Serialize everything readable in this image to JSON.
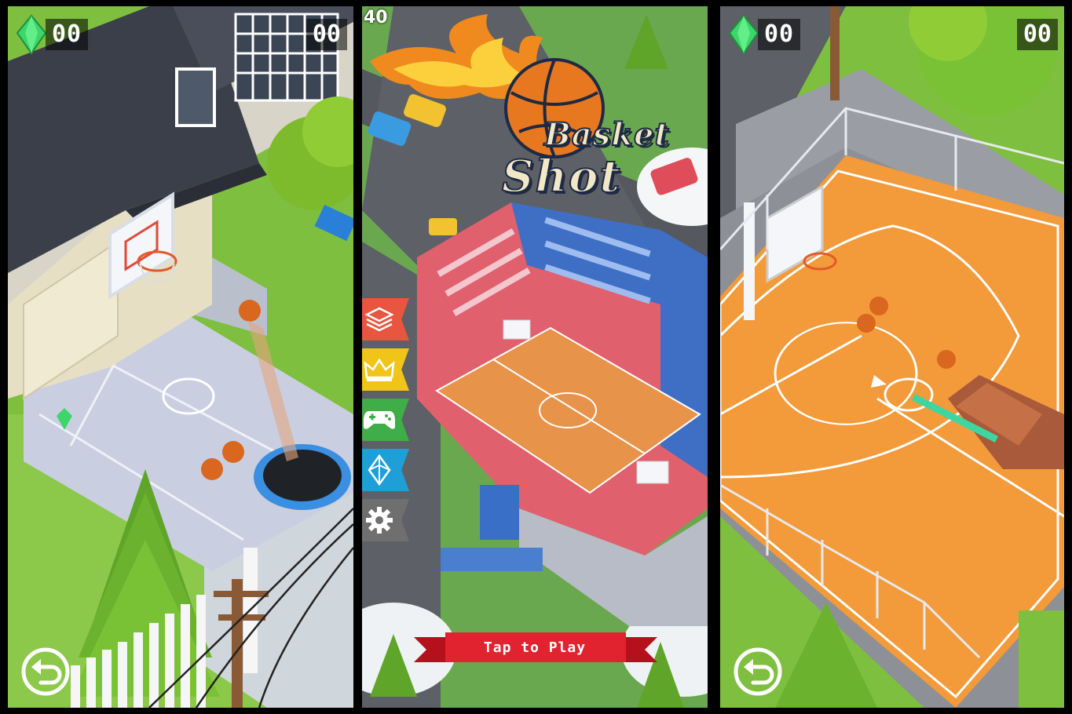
{
  "screens": [
    {
      "id": "backyard",
      "gems": "00",
      "score": "00",
      "back_icon": "undo-arrow-icon"
    },
    {
      "id": "title",
      "fps": "40",
      "logo_line1": "Basket",
      "logo_line2": "Shot",
      "tap_to_play": "Tap to Play",
      "menu": [
        {
          "icon": "layers-icon",
          "color": "#e8563f"
        },
        {
          "icon": "crown-icon",
          "color": "#f0c419"
        },
        {
          "icon": "gamepad-icon",
          "color": "#3fae49"
        },
        {
          "icon": "diamond-icon",
          "color": "#1f9fd8"
        },
        {
          "icon": "gear-icon",
          "color": "#6f6f6f"
        }
      ]
    },
    {
      "id": "court",
      "gems": "00",
      "score": "00",
      "back_icon": "undo-arrow-icon"
    }
  ],
  "colors": {
    "gem": "#3ed66a",
    "banner_red": "#e0232e",
    "court_orange": "#f39a3a",
    "grass": "#7fbf3f"
  }
}
